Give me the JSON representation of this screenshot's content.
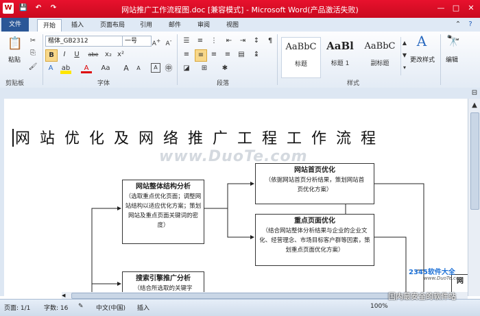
{
  "titlebar": {
    "title": "网站推广工作流程图.doc [兼容模式] - Microsoft Word(产品激活失败)",
    "quick_access": [
      "W",
      "💾",
      "↶",
      "↷"
    ],
    "window_buttons": [
      "—",
      "□",
      "✕"
    ]
  },
  "ribbon_tabs": {
    "file": "文件",
    "items": [
      "开始",
      "插入",
      "页面布局",
      "引用",
      "邮件",
      "审阅",
      "视图"
    ]
  },
  "ribbon": {
    "clipboard": {
      "label": "剪贴板",
      "paste": "粘贴"
    },
    "font": {
      "label": "字体",
      "font_name": "楷体_GB2312",
      "font_size": "一号",
      "buttons": [
        "B",
        "I",
        "U",
        "abe",
        "x₂",
        "x²",
        "A",
        "Aa",
        "A",
        "A"
      ]
    },
    "paragraph": {
      "label": "段落"
    },
    "styles": {
      "label": "样式",
      "items": [
        {
          "preview": "AaBbC",
          "name": "标题"
        },
        {
          "preview": "AaBl",
          "name": "标题 1"
        },
        {
          "preview": "AaBbC",
          "name": "副标题"
        }
      ],
      "change_styles": "更改样式"
    },
    "editing": {
      "label": "编辑"
    }
  },
  "document": {
    "title": "网站优化及网络推广工程工作流程",
    "watermark": "www.DuoTe.com",
    "boxes": {
      "structure": {
        "heading": "网站整体结构分析",
        "body": "（选取重点优化页面；调整网站结构以适应优化方案；策划网站及重点页面关键词的密度）"
      },
      "homepage": {
        "heading": "网站首页优化",
        "body": "（依据网站首页分析结果，策划网站首页优化方案）"
      },
      "keypage": {
        "heading": "重点页面优化",
        "body": "（结合网站整体分析结果与企业的企业文化、经营理念、市场目标客户群等因素，策划重点页面优化方案）"
      },
      "seo": {
        "heading": "搜索引擎推广分析",
        "body": "（结合所选取的关键字"
      }
    },
    "corner_text": "网"
  },
  "statusbar": {
    "page": "页面: 1/1",
    "words": "字数: 16",
    "language": "中文(中国)",
    "mode": "插入",
    "zoom": "100%"
  },
  "corner_logo": {
    "brand": "2345软件大全",
    "url": "www.DuoTe.com",
    "slogan": "国内最安全的软件站"
  },
  "colors": {
    "titlebar": "#d8102a",
    "file_tab": "#2b5797",
    "ribbon": "#e3ebf5"
  }
}
